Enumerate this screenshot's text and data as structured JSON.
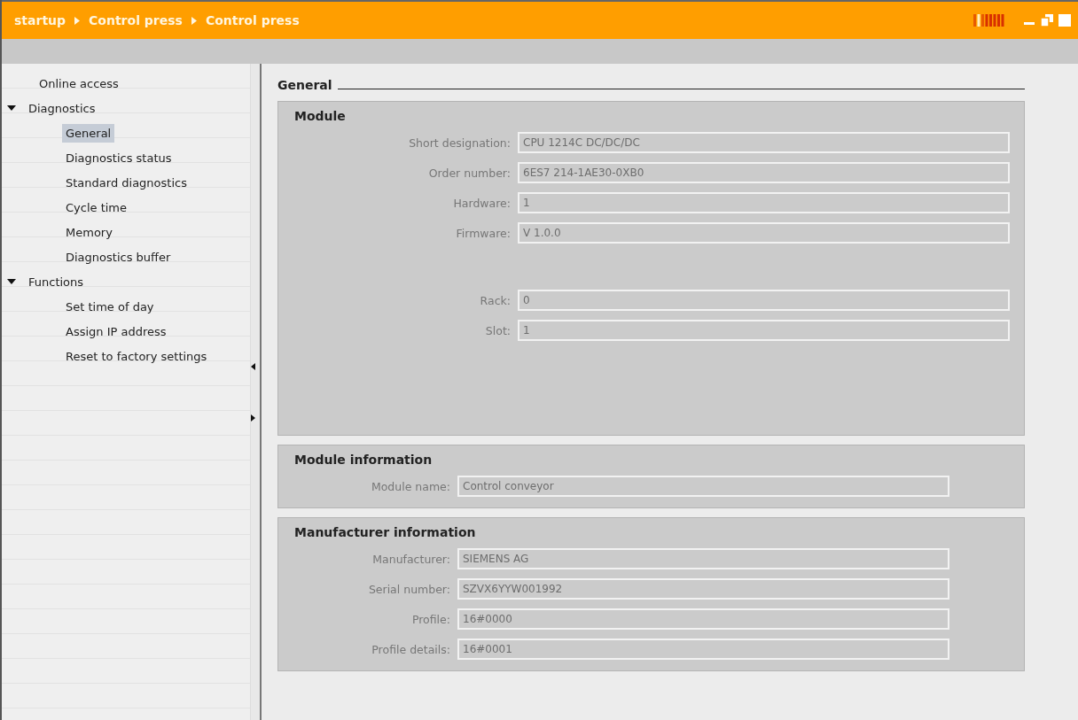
{
  "breadcrumb": [
    "startup",
    "Control press",
    "Control press"
  ],
  "sidebar": {
    "items": [
      {
        "label": "Online access",
        "selected": false
      },
      {
        "label": "Diagnostics",
        "selected": false,
        "expanded": true,
        "children": [
          {
            "label": "General",
            "selected": true
          },
          {
            "label": "Diagnostics status",
            "selected": false
          },
          {
            "label": "Standard diagnostics",
            "selected": false
          },
          {
            "label": "Cycle time",
            "selected": false
          },
          {
            "label": "Memory",
            "selected": false
          },
          {
            "label": "Diagnostics buffer",
            "selected": false
          }
        ]
      },
      {
        "label": "Functions",
        "selected": false,
        "expanded": true,
        "children": [
          {
            "label": "Set time of day",
            "selected": false
          },
          {
            "label": "Assign IP address",
            "selected": false
          },
          {
            "label": "Reset to factory settings",
            "selected": false
          }
        ]
      }
    ]
  },
  "page_title": "General",
  "sections": [
    {
      "title": "Module",
      "field_groups": [
        [
          {
            "label": "Short designation:",
            "value": "CPU 1214C DC/DC/DC"
          },
          {
            "label": "Order number:",
            "value": "6ES7 214-1AE30-0XB0"
          },
          {
            "label": "Hardware:",
            "value": "1"
          },
          {
            "label": "Firmware:",
            "value": "V 1.0.0"
          }
        ],
        [
          {
            "label": "Rack:",
            "value": "0"
          },
          {
            "label": "Slot:",
            "value": "1"
          }
        ]
      ]
    },
    {
      "title": "Module information",
      "field_groups": [
        [
          {
            "label": "Module name:",
            "value": "Control conveyor"
          }
        ]
      ]
    },
    {
      "title": "Manufacturer information",
      "field_groups": [
        [
          {
            "label": "Manufacturer:",
            "value": "SIEMENS AG"
          },
          {
            "label": "Serial number:",
            "value": "SZVX6YYW001992"
          },
          {
            "label": "Profile:",
            "value": "16#0000"
          },
          {
            "label": "Profile details:",
            "value": "16#0001"
          }
        ]
      ]
    }
  ]
}
